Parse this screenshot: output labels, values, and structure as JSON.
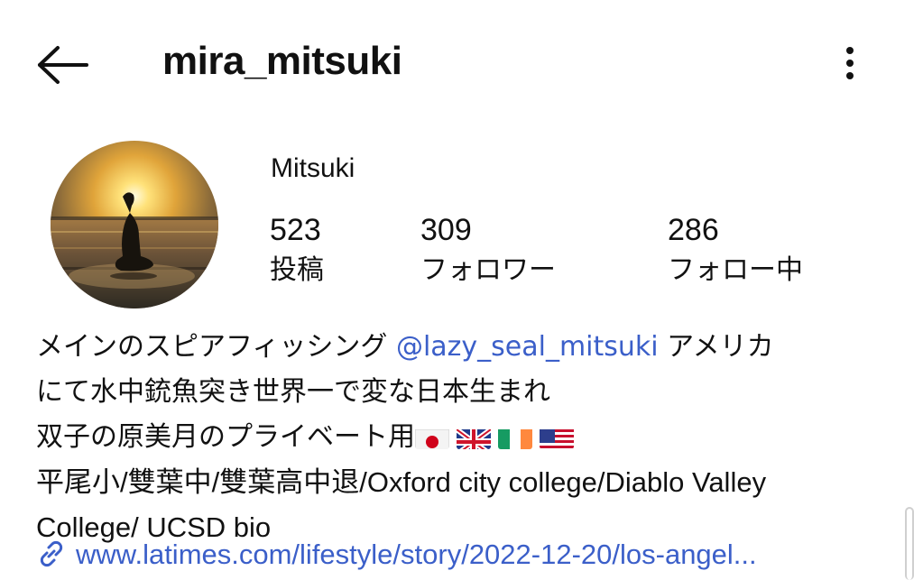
{
  "header": {
    "username": "mira_mitsuki",
    "back_icon": "arrow-left-icon",
    "more_icon": "vertical-dots-icon"
  },
  "profile": {
    "display_name": "Mitsuki",
    "avatar": "sunset-silhouette-photo",
    "stats": {
      "posts": {
        "count": "523",
        "label": "投稿"
      },
      "followers": {
        "count": "309",
        "label": "フォロワー"
      },
      "following": {
        "count": "286",
        "label": "フォロー中"
      }
    }
  },
  "bio": {
    "line1_before": "メインのスピアフィッシング ",
    "mention": "@lazy_seal_mitsuki",
    "line1_after": " アメリカ",
    "line2": "にて水中銃魚突き世界一で変な日本生まれ",
    "line3": "双子の原美月のプライベート用",
    "flags": [
      "japan-flag",
      "uk-flag",
      "ireland-flag",
      "usa-flag"
    ],
    "line4": "平尾小/雙葉中/雙葉高中退/Oxford city college/Diablo Valley",
    "line5": "College/ UCSD bio"
  },
  "link": {
    "text": "www.latimes.com/lifestyle/story/2022-12-20/los-angel...",
    "icon": "link-icon"
  },
  "colors": {
    "link": "#3b5fc9",
    "text": "#111111"
  }
}
